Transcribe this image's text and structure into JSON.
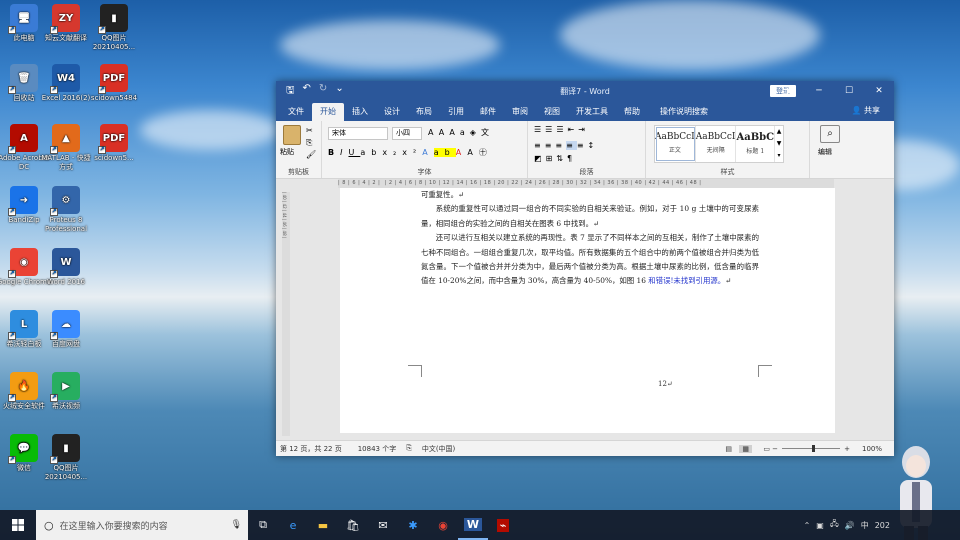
{
  "desktop": {
    "icons": [
      {
        "label": "此电脑",
        "glyph": "🖥",
        "color": "#3a7bd5"
      },
      {
        "label": "知云文献翻译",
        "glyph": "ZY",
        "color": "#d6382e"
      },
      {
        "label": "QQ图片 20210405...",
        "glyph": "▮",
        "color": "#222"
      },
      {
        "label": "回收站",
        "glyph": "🗑",
        "color": "#5a8bc0"
      },
      {
        "label": "Excel 2016(2)",
        "glyph": "W4",
        "color": "#1e5aa8"
      },
      {
        "label": "scidown5484",
        "glyph": "PDF",
        "color": "#d93025"
      },
      {
        "label": "Adobe Acrobat DC",
        "glyph": "A",
        "color": "#b30b00"
      },
      {
        "label": "MATLAB - 快捷方式",
        "glyph": "▲",
        "color": "#e26a1b"
      },
      {
        "label": "scidown5...",
        "glyph": "PDF",
        "color": "#d93025"
      },
      {
        "label": "BandiZip",
        "glyph": "➜",
        "color": "#1a73e8"
      },
      {
        "label": "Proteus 8 Professional",
        "glyph": "⚙",
        "color": "#3366aa"
      },
      {
        "label": "Google Chrome",
        "glyph": "◉",
        "color": "#ea4335"
      },
      {
        "label": "Word 2016",
        "glyph": "W",
        "color": "#2b579a"
      },
      {
        "label": "希沃轻白板",
        "glyph": "L",
        "color": "#2e8ddf"
      },
      {
        "label": "百度网盘",
        "glyph": "☁",
        "color": "#3b8cff"
      },
      {
        "label": "火绒安全软件",
        "glyph": "🔥",
        "color": "#f39c12"
      },
      {
        "label": "希沃视频",
        "glyph": "▶",
        "color": "#27ae60"
      },
      {
        "label": "微信",
        "glyph": "💬",
        "color": "#09bb07"
      },
      {
        "label": "QQ图片 20210405...",
        "glyph": "▮",
        "color": "#222"
      }
    ]
  },
  "word": {
    "title": "翻译7 - Word",
    "login_label": "登录",
    "tabs": [
      "文件",
      "开始",
      "插入",
      "设计",
      "布局",
      "引用",
      "邮件",
      "审阅",
      "视图",
      "开发工具",
      "帮助",
      "操作说明搜索"
    ],
    "share_label": "共享",
    "ribbon": {
      "clipboard": {
        "label": "剪贴板",
        "paste": "粘贴"
      },
      "font": {
        "label": "字体",
        "font_name": "宋体",
        "font_size": "小四"
      },
      "paragraph": {
        "label": "段落"
      },
      "styles": {
        "label": "样式",
        "items": [
          {
            "sample": "AaBbCcI",
            "name": "正文"
          },
          {
            "sample": "AaBbCcI",
            "name": "无间隔"
          },
          {
            "sample": "AaBbC",
            "name": "标题 1"
          }
        ]
      },
      "editing": {
        "label": "编辑"
      }
    },
    "document": {
      "line_top": "可重复性。↵",
      "para1": "系统的重复性可以通过同一组合的不同实验的自相关来验证。例如，对于 10 g 土壤中的可变尿素量，相同组合的实验之间的自相关在图表 6 中找到。↵",
      "para2": "还可以进行互相关以建立系统的再现性。表 7 显示了不同样本之间的互相关，制作了土壤中尿素的七种不同组合。一组组合重复几次，取平均值。所有数据集的五个组合中的前两个值被组合并归类为低氮含量。下一个值被合并并分类为中，最后两个值被分类为高。根据土壤中尿素的比例，低含量的临界值在 10-20%之间，而中含量为 30%，高含量为 40-50%，如图 16",
      "error_text": "和错误!未找到引用源。",
      "para2_end": "↵",
      "page_number": "12↵"
    },
    "status": {
      "page": "第 12 页，共 22 页",
      "words": "10843 个字",
      "language": "中文(中国)",
      "zoom": "100%"
    }
  },
  "taskbar": {
    "search_placeholder": "在这里输入你要搜索的内容",
    "tray_time": "202",
    "ime": "中"
  }
}
